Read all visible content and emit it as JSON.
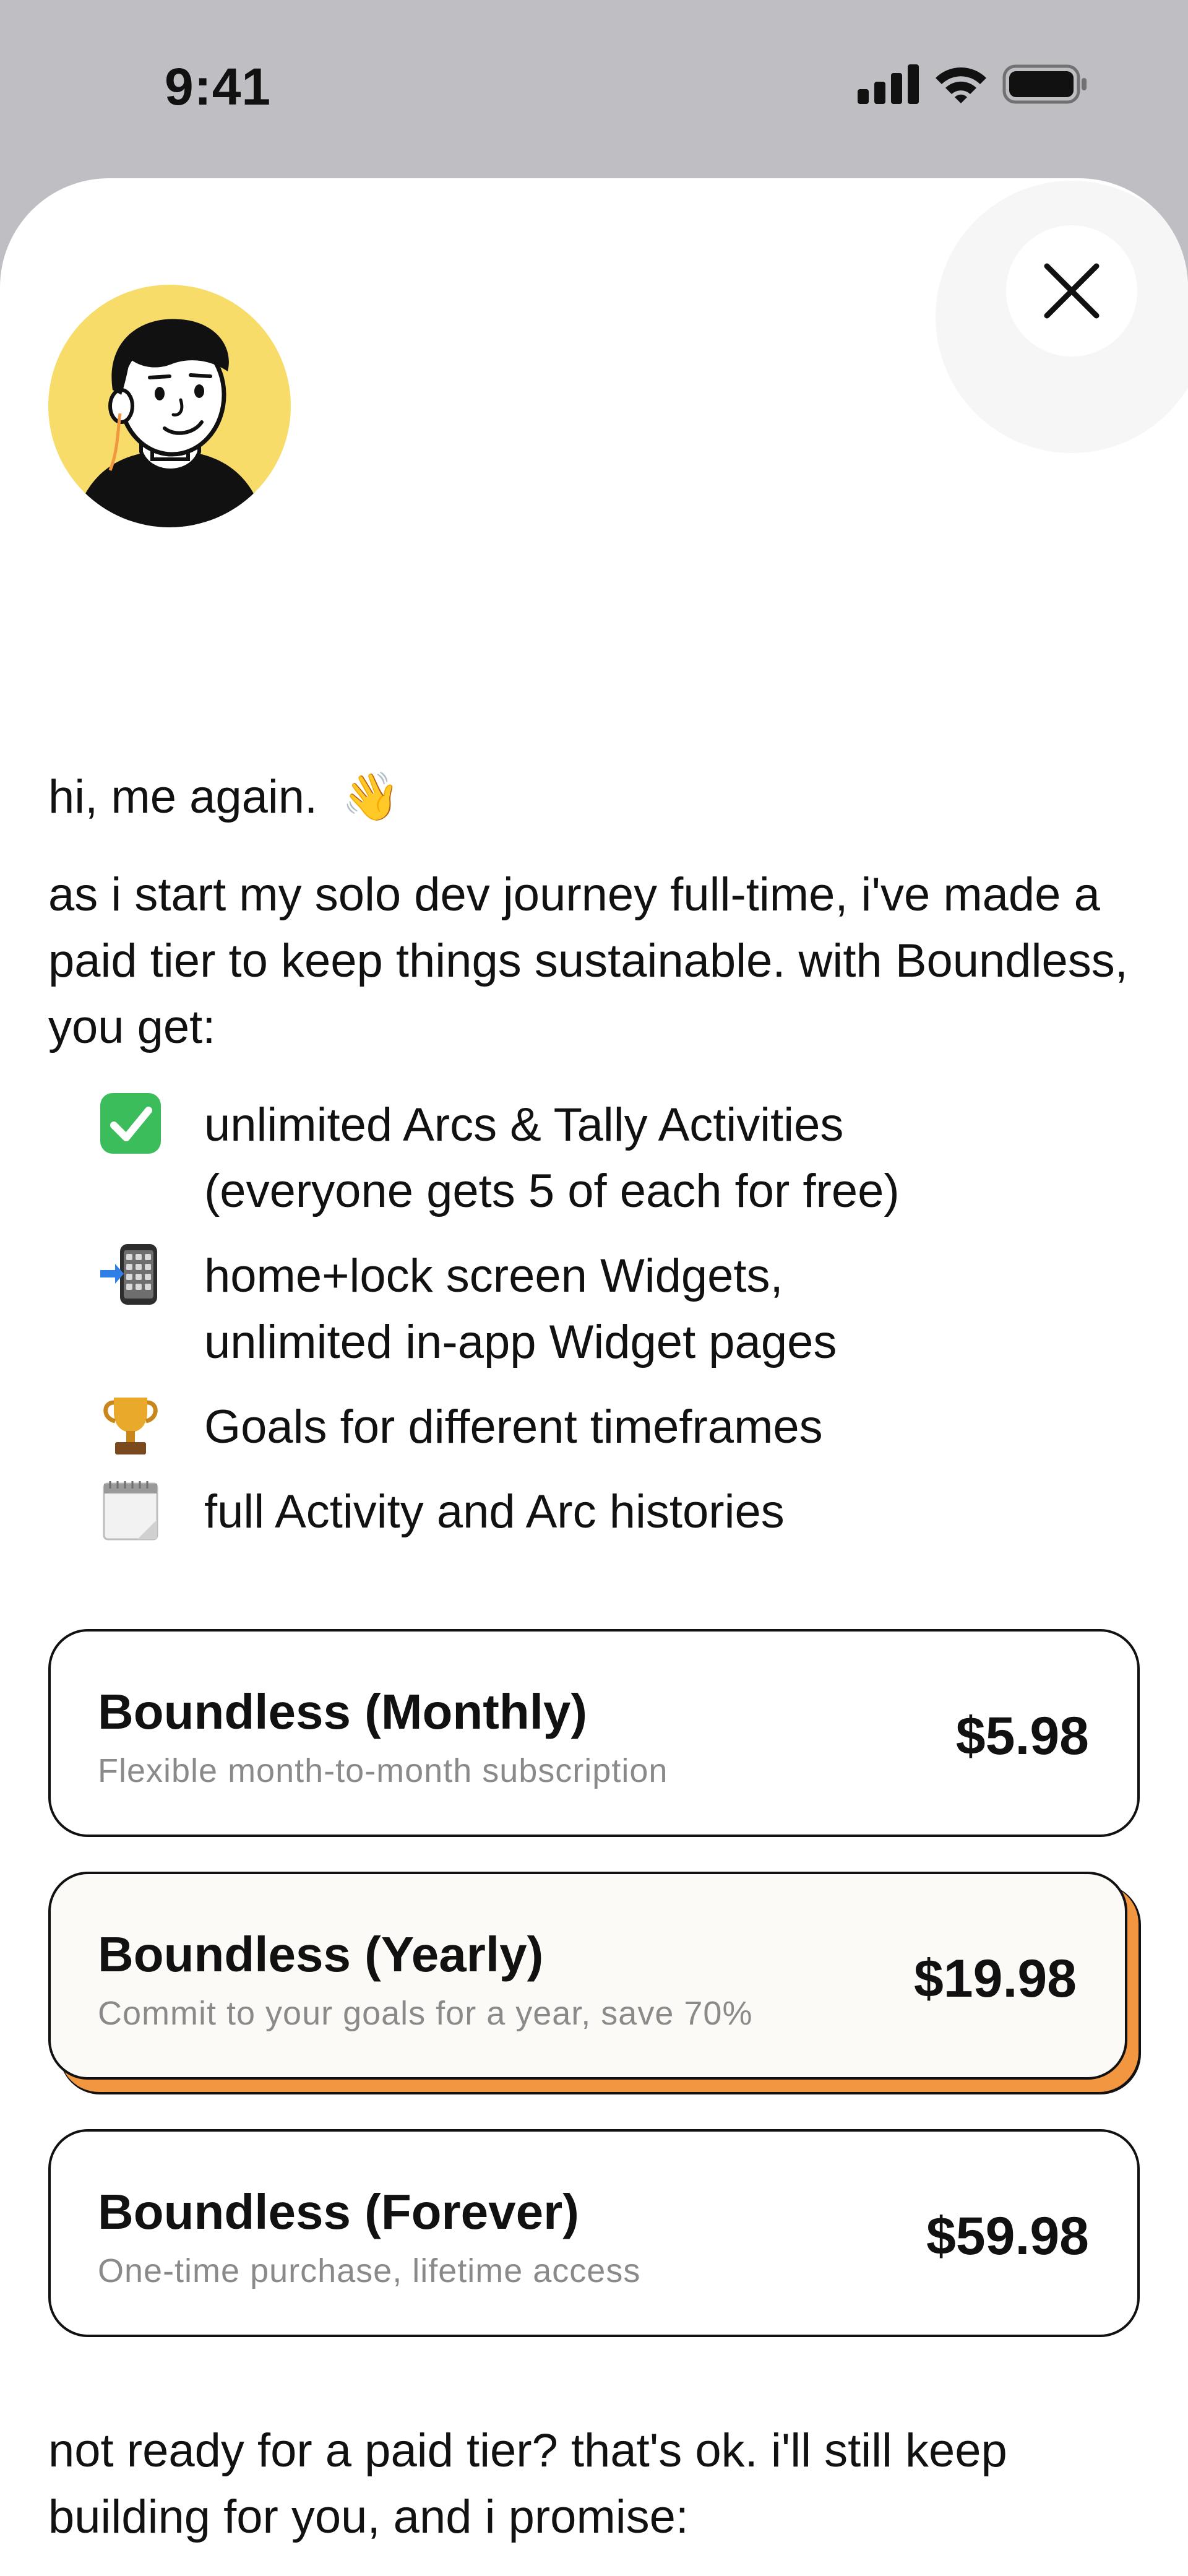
{
  "status_bar": {
    "time": "9:41"
  },
  "greeting": {
    "text": "hi, me again.",
    "emoji": "👋"
  },
  "intro": {
    "text": "as i start my solo dev journey full-time, i've made a paid tier to keep things sustainable. with Boundless, you get:"
  },
  "features": [
    {
      "icon": "check-icon",
      "line1": "unlimited Arcs & Tally Activities",
      "line2": "(everyone gets 5 of each for free)"
    },
    {
      "icon": "phone-arrow-icon",
      "line1": "home+lock screen Widgets,",
      "line2": "unlimited in-app Widget pages"
    },
    {
      "icon": "trophy-icon",
      "line1": "Goals for different timeframes",
      "line2": ""
    },
    {
      "icon": "calendar-icon",
      "line1": "full Activity and Arc histories",
      "line2": ""
    }
  ],
  "plans": [
    {
      "title": "Boundless (Monthly)",
      "description": "Flexible month-to-month subscription",
      "price": "$5.98",
      "selected": false
    },
    {
      "title": "Boundless (Yearly)",
      "description": "Commit to your goals for a year, save 70%",
      "price": "$19.98",
      "selected": true
    },
    {
      "title": "Boundless (Forever)",
      "description": "One-time purchase, lifetime access",
      "price": "$59.98",
      "selected": false
    }
  ],
  "footer": {
    "text": "not ready for a paid tier? that's ok. i'll still keep building for you, and i promise:"
  },
  "colors": {
    "accent_orange": "#f2963f",
    "avatar_yellow": "#f8dc6a",
    "check_green": "#3cbd5b"
  }
}
